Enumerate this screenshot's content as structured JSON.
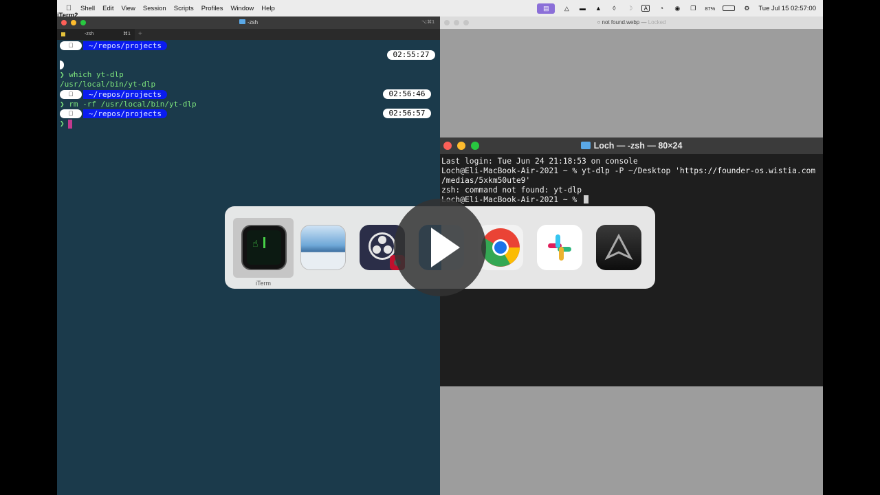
{
  "menubar": {
    "app": "iTerm2",
    "items": [
      "Shell",
      "Edit",
      "View",
      "Session",
      "Scripts",
      "Profiles",
      "Window",
      "Help"
    ],
    "battery": "87%",
    "clock": "Tue Jul 15  02:57:00"
  },
  "iterm": {
    "title": "-zsh",
    "shortcut": "⌥⌘1",
    "tab_label": "-zsh",
    "tab_num": "⌘1",
    "path": "~/repos/projects",
    "times": [
      "02:55:27",
      "02:56:46",
      "02:56:57"
    ],
    "lines": [
      "❯ which yt-dlp",
      "/usr/local/bin/yt-dlp",
      "❯ rm -rf /usr/local/bin/yt-dlp",
      "❯"
    ]
  },
  "preview": {
    "title": "not found.webp",
    "status": "Locked"
  },
  "terminal": {
    "title": "Loch — -zsh — 80×24",
    "lines": [
      "Last login: Tue Jun 24 21:18:53 on console",
      "Loch@Eli-MacBook-Air-2021 ~ % yt-dlp -P ~/Desktop 'https://founder-os.wistia.com",
      "/medias/5xkm50ute9'",
      "zsh: command not found: yt-dlp",
      "Loch@Eli-MacBook-Air-2021 ~ % "
    ]
  },
  "switcher": {
    "selected_label": "iTerm",
    "apps": [
      "iterm-icon",
      "preview-icon",
      "obs-icon",
      "finder-icon",
      "chrome-icon",
      "slack-icon",
      "arc-icon"
    ]
  },
  "colors": {
    "iterm_bg": "#1b3a4b",
    "path_pill": "#0a1cf0",
    "term_green": "#7de37d",
    "cursor_pink": "#c23a8e"
  }
}
